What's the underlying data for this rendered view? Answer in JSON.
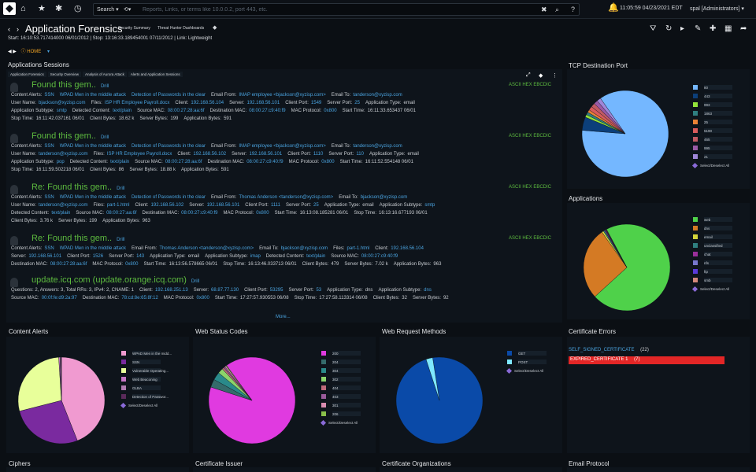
{
  "topbar": {
    "search_label": "Search ▾",
    "history_label": "⟲▾",
    "search_placeholder": "Reports, Links, or terms like 10.0.0.2, port 443, etc.",
    "datetime": "11:05:59 04/23/2021 EDT",
    "user": "spal [Administrators] ▾"
  },
  "page": {
    "title": "Application Forensics",
    "tabs": [
      "Security Summary",
      "Threat Hunter Dashboards"
    ],
    "times": "Start: 16:10:53.717414000 06/01/2012 | Stop: 13:16:33.189454001 07/11/2012 | Link: Lightweight",
    "home": "HOME"
  },
  "sessions_panel": {
    "title": "Applications Sessions",
    "subtabs": [
      "Application Forensics",
      "Security Overview",
      "Analysis of Aurora Attack",
      "Alerts and Application Sessions"
    ],
    "more": "More...",
    "drill": "Drill",
    "formats": "ASCII  HEX  EBCDIC"
  },
  "sessions": [
    {
      "heading": "Found this gem..",
      "rows": [
        [
          [
            "Content Alerts:",
            ""
          ],
          [
            "SSN",
            "v"
          ],
          [
            "WPAD Men in the middle attack",
            "v"
          ],
          [
            "Detection of Passwords in the clear",
            "v"
          ],
          [
            "Email From:",
            ""
          ],
          [
            "IMAP employee <bjackson@xyzisp.com>",
            "v"
          ],
          [
            "Email To:",
            ""
          ],
          [
            "tanderson@xyzisp.com",
            "v"
          ]
        ],
        [
          [
            "User Name:",
            ""
          ],
          [
            "bjackson@xyzisp.com",
            "v"
          ],
          [
            "Files:",
            ""
          ],
          [
            "ISP HR Employee Payroll.docx",
            "v"
          ],
          [
            "Client:",
            ""
          ],
          [
            "192.168.56.104",
            "v"
          ],
          [
            "Server:",
            ""
          ],
          [
            "192.168.56.101",
            "v"
          ],
          [
            "Client Port:",
            ""
          ],
          [
            "1549",
            "v"
          ],
          [
            "Server Port:",
            ""
          ],
          [
            "25",
            "v"
          ],
          [
            "Application Type:",
            ""
          ],
          [
            "email",
            ""
          ]
        ],
        [
          [
            "Application Subtype:",
            ""
          ],
          [
            "smtp",
            "v"
          ],
          [
            "Detected Content:",
            ""
          ],
          [
            "text/plain",
            "v"
          ],
          [
            "Source MAC:",
            ""
          ],
          [
            "08:00:27:28:aa:6f",
            "v"
          ],
          [
            "Destination MAC:",
            ""
          ],
          [
            "08:00:27:c9:40:f9",
            "v"
          ],
          [
            "MAC Protocol:",
            ""
          ],
          [
            "0x800",
            "v"
          ],
          [
            "Start Time:",
            ""
          ],
          [
            "16:11:33.653437 06/01",
            ""
          ]
        ],
        [
          [
            "Stop Time:",
            ""
          ],
          [
            "16:11:42.037161 06/01",
            ""
          ],
          [
            "Client Bytes:",
            ""
          ],
          [
            "18.62 k",
            ""
          ],
          [
            "Server Bytes:",
            ""
          ],
          [
            "199",
            ""
          ],
          [
            "Application Bytes:",
            ""
          ],
          [
            "591",
            ""
          ]
        ]
      ]
    },
    {
      "heading": "Found this gem..",
      "rows": [
        [
          [
            "Content Alerts:",
            ""
          ],
          [
            "SSN",
            "v"
          ],
          [
            "WPAD Men in the middle attack",
            "v"
          ],
          [
            "Detection of Passwords in the clear",
            "v"
          ],
          [
            "Email From:",
            ""
          ],
          [
            "IMAP employee <bjackson@xyzisp.com>",
            "v"
          ],
          [
            "Email To:",
            ""
          ],
          [
            "tanderson@xyzisp.com",
            "v"
          ]
        ],
        [
          [
            "User Name:",
            ""
          ],
          [
            "tanderson@xyzisp.com",
            "v"
          ],
          [
            "Files:",
            ""
          ],
          [
            "ISP HR Employee Payroll.docx",
            "v"
          ],
          [
            "Client:",
            ""
          ],
          [
            "192.168.56.102",
            "v"
          ],
          [
            "Server:",
            ""
          ],
          [
            "192.168.56.101",
            "v"
          ],
          [
            "Client Port:",
            ""
          ],
          [
            "1110",
            "v"
          ],
          [
            "Server Port:",
            ""
          ],
          [
            "110",
            "v"
          ],
          [
            "Application Type:",
            ""
          ],
          [
            "email",
            ""
          ]
        ],
        [
          [
            "Application Subtype:",
            ""
          ],
          [
            "pop",
            "v"
          ],
          [
            "Detected Content:",
            ""
          ],
          [
            "text/plain",
            "v"
          ],
          [
            "Source MAC:",
            ""
          ],
          [
            "08:00:27:28:aa:6f",
            "v"
          ],
          [
            "Destination MAC:",
            ""
          ],
          [
            "08:00:27:c9:40:f9",
            "v"
          ],
          [
            "MAC Protocol:",
            ""
          ],
          [
            "0x800",
            "v"
          ],
          [
            "Start Time:",
            ""
          ],
          [
            "16:11:52.554148 06/01",
            ""
          ]
        ],
        [
          [
            "Stop Time:",
            ""
          ],
          [
            "16:11:59.502218 06/01",
            ""
          ],
          [
            "Client Bytes:",
            ""
          ],
          [
            "86",
            ""
          ],
          [
            "Server Bytes:",
            ""
          ],
          [
            "18.88 k",
            ""
          ],
          [
            "Application Bytes:",
            ""
          ],
          [
            "591",
            ""
          ]
        ]
      ]
    },
    {
      "heading": "Re: Found this gem..",
      "rows": [
        [
          [
            "Content Alerts:",
            ""
          ],
          [
            "SSN",
            "v"
          ],
          [
            "WPAD Men in the middle attack",
            "v"
          ],
          [
            "Detection of Passwords in the clear",
            "v"
          ],
          [
            "Email From:",
            ""
          ],
          [
            "Thomas Anderson <tanderson@xyzisp.com>",
            "v"
          ],
          [
            "Email To:",
            ""
          ],
          [
            "bjackson@xyzisp.com",
            "v"
          ]
        ],
        [
          [
            "User Name:",
            ""
          ],
          [
            "tanderson@xyzisp.com",
            "v"
          ],
          [
            "Files:",
            ""
          ],
          [
            "part-1.html",
            "v"
          ],
          [
            "Client:",
            ""
          ],
          [
            "192.168.56.102",
            "v"
          ],
          [
            "Server:",
            ""
          ],
          [
            "192.168.56.101",
            "v"
          ],
          [
            "Client Port:",
            ""
          ],
          [
            "1111",
            "v"
          ],
          [
            "Server Port:",
            ""
          ],
          [
            "25",
            "v"
          ],
          [
            "Application Type:",
            ""
          ],
          [
            "email",
            ""
          ],
          [
            "Application Subtype:",
            ""
          ],
          [
            "smtp",
            "v"
          ]
        ],
        [
          [
            "Detected Content:",
            ""
          ],
          [
            "text/plain",
            "v"
          ],
          [
            "Source MAC:",
            ""
          ],
          [
            "08:00:27:aa:6f",
            "v"
          ],
          [
            "Destination MAC:",
            ""
          ],
          [
            "08:00:27:c9:40:f9",
            "v"
          ],
          [
            "MAC Protocol:",
            ""
          ],
          [
            "0x800",
            "v"
          ],
          [
            "Start Time:",
            ""
          ],
          [
            "16:13:08.185281 06/01",
            ""
          ],
          [
            "Stop Time:",
            ""
          ],
          [
            "16:13:16.677193 06/01",
            ""
          ]
        ],
        [
          [
            "Client Bytes:",
            ""
          ],
          [
            "3.76 k",
            ""
          ],
          [
            "Server Bytes:",
            ""
          ],
          [
            "199",
            ""
          ],
          [
            "Application Bytes:",
            ""
          ],
          [
            "963",
            ""
          ]
        ]
      ]
    },
    {
      "heading": "Re: Found this gem..",
      "rows": [
        [
          [
            "Content Alerts:",
            ""
          ],
          [
            "SSN",
            "v"
          ],
          [
            "WPAD Men in the middle attack",
            "v"
          ],
          [
            "Email From:",
            ""
          ],
          [
            "Thomas Anderson <tanderson@xyzisp.com>",
            "v"
          ],
          [
            "Email To:",
            ""
          ],
          [
            "bjackson@xyzisp.com",
            "v"
          ],
          [
            "Files:",
            ""
          ],
          [
            "part-1.html",
            "v"
          ],
          [
            "Client:",
            ""
          ],
          [
            "192.168.56.104",
            "v"
          ]
        ],
        [
          [
            "Server:",
            ""
          ],
          [
            "192.168.56.101",
            "v"
          ],
          [
            "Client Port:",
            ""
          ],
          [
            "1526",
            "v"
          ],
          [
            "Server Port:",
            ""
          ],
          [
            "143",
            "v"
          ],
          [
            "Application Type:",
            ""
          ],
          [
            "email",
            ""
          ],
          [
            "Application Subtype:",
            ""
          ],
          [
            "imap",
            "v"
          ],
          [
            "Detected Content:",
            ""
          ],
          [
            "text/plain",
            "v"
          ],
          [
            "Source MAC:",
            ""
          ],
          [
            "08:00:27:c9:40:f9",
            "v"
          ]
        ],
        [
          [
            "Destination MAC:",
            ""
          ],
          [
            "08:00:27:28:aa:6f",
            "v"
          ],
          [
            "MAC Protocol:",
            ""
          ],
          [
            "0x800",
            "v"
          ],
          [
            "Start Time:",
            ""
          ],
          [
            "16:13:56.578665 06/01",
            ""
          ],
          [
            "Stop Time:",
            ""
          ],
          [
            "16:13:46.033713 06/01",
            ""
          ],
          [
            "Client Bytes:",
            ""
          ],
          [
            "479",
            ""
          ],
          [
            "Server Bytes:",
            ""
          ],
          [
            "7.02 k",
            ""
          ],
          [
            "Application Bytes:",
            ""
          ],
          [
            "963",
            ""
          ]
        ]
      ]
    },
    {
      "heading": "update.icq.com (update.orange.icq.com)",
      "rows": [
        [
          [
            "Questions: 2, Answers: 3, Total RRs: 3, IPv4: 2, CNAME: 1",
            ""
          ],
          [
            "Client:",
            ""
          ],
          [
            "192.168.251.13",
            "v"
          ],
          [
            "Server:",
            ""
          ],
          [
            "68.87.77.130",
            "v"
          ],
          [
            "Client Port:",
            ""
          ],
          [
            "53295",
            "v"
          ],
          [
            "Server Port:",
            ""
          ],
          [
            "53",
            "v"
          ],
          [
            "Application Type:",
            ""
          ],
          [
            "dns",
            ""
          ],
          [
            "Application Subtype:",
            ""
          ],
          [
            "dns",
            "v"
          ]
        ],
        [
          [
            "Source MAC:",
            ""
          ],
          [
            "00:0f:fe:d9:2a:97",
            "v"
          ],
          [
            "Destination MAC:",
            ""
          ],
          [
            "78:cd:8e:65:8f:12",
            "v"
          ],
          [
            "MAC Protocol:",
            ""
          ],
          [
            "0x800",
            "v"
          ],
          [
            "Start Time:",
            ""
          ],
          [
            "17:27:57.930553 06/08",
            ""
          ],
          [
            "Stop Time:",
            ""
          ],
          [
            "17:27:58.113314 06/08",
            ""
          ],
          [
            "Client Bytes:",
            ""
          ],
          [
            "32",
            ""
          ],
          [
            "Server Bytes:",
            ""
          ],
          [
            "92",
            ""
          ]
        ]
      ]
    }
  ],
  "tcp_port": {
    "title": "TCP Destination Port",
    "select_all": "Select/Deselect All",
    "items": [
      {
        "label": "80",
        "color": "#74b7ff",
        "value": 86
      },
      {
        "label": "443",
        "color": "#0c3f7a",
        "value": 5
      },
      {
        "label": "993",
        "color": "#93e33a",
        "value": 1
      },
      {
        "label": "1863",
        "color": "#2f7f80",
        "value": 1
      },
      {
        "label": "25",
        "color": "#e98235",
        "value": 1
      },
      {
        "label": "5190",
        "color": "#d95b5b",
        "value": 1.5
      },
      {
        "label": "465",
        "color": "#c15a63",
        "value": 1.5
      },
      {
        "label": "995",
        "color": "#9a5aa6",
        "value": 1.5
      },
      {
        "label": "21",
        "color": "#9f86d8",
        "value": 1.5
      }
    ]
  },
  "applications": {
    "title": "Applications",
    "select_all": "Select/Deselect All",
    "items": [
      {
        "label": "web",
        "color": "#4fd14a",
        "value": 71
      },
      {
        "label": "dns",
        "color": "#d47a24",
        "value": 27
      },
      {
        "label": "email",
        "color": "#d4d43a",
        "value": 0.7
      },
      {
        "label": "unclassified",
        "color": "#2f7f80",
        "value": 0.5
      },
      {
        "label": "chat",
        "color": "#9a2f9a",
        "value": 0.3
      },
      {
        "label": "nfs",
        "color": "#7777cc",
        "value": 0.2
      },
      {
        "label": "ftp",
        "color": "#5a3ad8",
        "value": 0.15
      },
      {
        "label": "smb",
        "color": "#d4887a",
        "value": 0.15
      }
    ]
  },
  "content_alerts": {
    "title": "Content Alerts",
    "select_all": "Select/Deselect All",
    "items": [
      {
        "label": "WPAD Men in the midd...",
        "color": "#f09ad0",
        "value": 44
      },
      {
        "label": "SSN",
        "color": "#7a2a9f",
        "value": 27
      },
      {
        "label": "Vulnerable Operating...",
        "color": "#e8ff9a",
        "value": 28
      },
      {
        "label": "Web Beaconing",
        "color": "#c877c8",
        "value": 0.5
      },
      {
        "label": "GLBA",
        "color": "#b07ab0",
        "value": 0.3
      },
      {
        "label": "Detection of Passwor...",
        "color": "#5a2a5a",
        "value": 0.2
      }
    ]
  },
  "web_status": {
    "title": "Web Status Codes",
    "select_all": "Select/Deselect All",
    "items": [
      {
        "label": "200",
        "color": "#e03ae0",
        "value": 90
      },
      {
        "label": "204",
        "color": "#356b6b",
        "value": 3
      },
      {
        "label": "304",
        "color": "#2a8a8a",
        "value": 3
      },
      {
        "label": "302",
        "color": "#8cd46a",
        "value": 2
      },
      {
        "label": "404",
        "color": "#bf6a7a",
        "value": 0.7
      },
      {
        "label": "403",
        "color": "#9a5a9a",
        "value": 0.5
      },
      {
        "label": "301",
        "color": "#d98cb0",
        "value": 0.5
      },
      {
        "label": "206",
        "color": "#8ac04a",
        "value": 0.3
      }
    ]
  },
  "web_methods": {
    "title": "Web Request Methods",
    "select_all": "Select/Deselect All",
    "items": [
      {
        "label": "GET",
        "color": "#0a4aa8",
        "value": 97.5
      },
      {
        "label": "POST",
        "color": "#7fe8ff",
        "value": 2.5
      }
    ]
  },
  "cert_errors": {
    "title": "Certificate Errors",
    "items": [
      {
        "label": "SELF_SIGNED_CERTIFICATE",
        "count": "(22)"
      },
      {
        "label": "EXPIRED_CERTIFICATE 1",
        "count": "(7)"
      }
    ]
  },
  "bottom": {
    "ciphers": "Ciphers",
    "cert_issuer": "Certificate Issuer",
    "cert_orgs": "Certificate Organizations",
    "email_protocol": "Email Protocol"
  }
}
